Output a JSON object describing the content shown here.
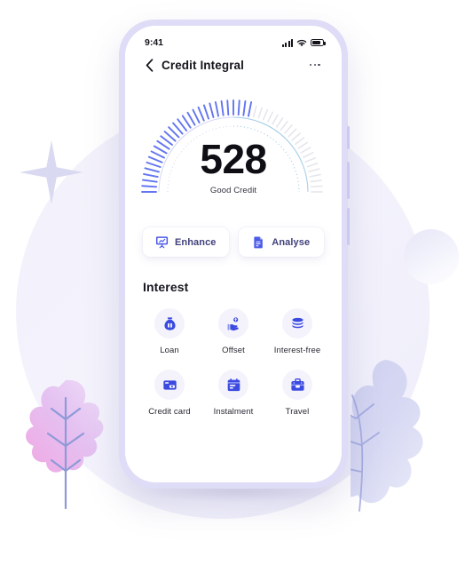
{
  "statusbar": {
    "time": "9:41",
    "signal_icon": "cellular-bars-icon",
    "wifi_icon": "wifi-icon",
    "battery_icon": "battery-icon"
  },
  "navbar": {
    "back_icon": "chevron-left-icon",
    "title": "Credit Integral",
    "more_icon": "more-options-icon"
  },
  "gauge": {
    "score": "528",
    "label": "Good Credit",
    "min": 0,
    "max": 1000,
    "value": 528,
    "active_color": "#5b6ef0",
    "inactive_color": "#dcdce6",
    "arc_color": "#c6cbf2",
    "arc_accent_color": "#a9d5e8"
  },
  "actions": [
    {
      "label": "Enhance",
      "icon": "presentation-chart-icon"
    },
    {
      "label": "Analyse",
      "icon": "document-text-icon"
    }
  ],
  "interest": {
    "title": "Interest",
    "items": [
      {
        "label": "Loan",
        "icon": "money-bag-icon"
      },
      {
        "label": "Offset",
        "icon": "hand-coin-icon"
      },
      {
        "label": "Interest-free",
        "icon": "coin-stack-icon"
      },
      {
        "label": "Credit card",
        "icon": "credit-card-icon"
      },
      {
        "label": "Instalment",
        "icon": "receipt-calendar-icon"
      },
      {
        "label": "Travel",
        "icon": "briefcase-icon"
      }
    ]
  },
  "theme": {
    "accent": "#3b4ae0",
    "accent_soft": "#5b6ef0",
    "icon_bg": "#f4f3fc",
    "page_bg": "#ffffff",
    "blob": "#f2f1fb",
    "phone_frame": "#dedcf6"
  }
}
